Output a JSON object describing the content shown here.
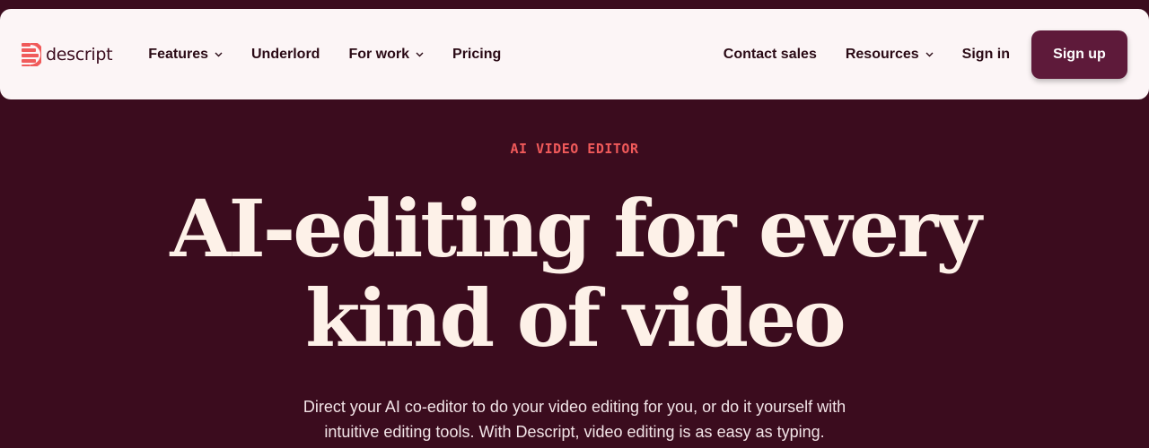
{
  "nav": {
    "logo_text": "descript",
    "links": [
      {
        "label": "Features",
        "has_dropdown": true
      },
      {
        "label": "Underlord",
        "has_dropdown": false
      },
      {
        "label": "For work",
        "has_dropdown": true
      },
      {
        "label": "Pricing",
        "has_dropdown": false
      }
    ],
    "right_links": [
      {
        "label": "Contact sales",
        "has_dropdown": false
      },
      {
        "label": "Resources",
        "has_dropdown": true
      },
      {
        "label": "Sign in",
        "has_dropdown": false
      }
    ],
    "signup_label": "Sign up"
  },
  "hero": {
    "eyebrow": "AI VIDEO EDITOR",
    "headline_line1": "AI-editing for every",
    "headline_line2": "kind of video",
    "sub_line1": "Direct your AI co-editor to do your video editing for you, or do it yourself with",
    "sub_line2": "intuitive editing tools. With Descript, video editing is as easy as typing."
  },
  "colors": {
    "background": "#3b0c1e",
    "nav_background": "#fcf5f6",
    "brand_red": "#f05a5a",
    "signup_button": "#5e1a3a",
    "headline": "#fdf1e8"
  },
  "icons": {
    "logo": "descript-logo-icon",
    "dropdown": "chevron-down-icon"
  }
}
